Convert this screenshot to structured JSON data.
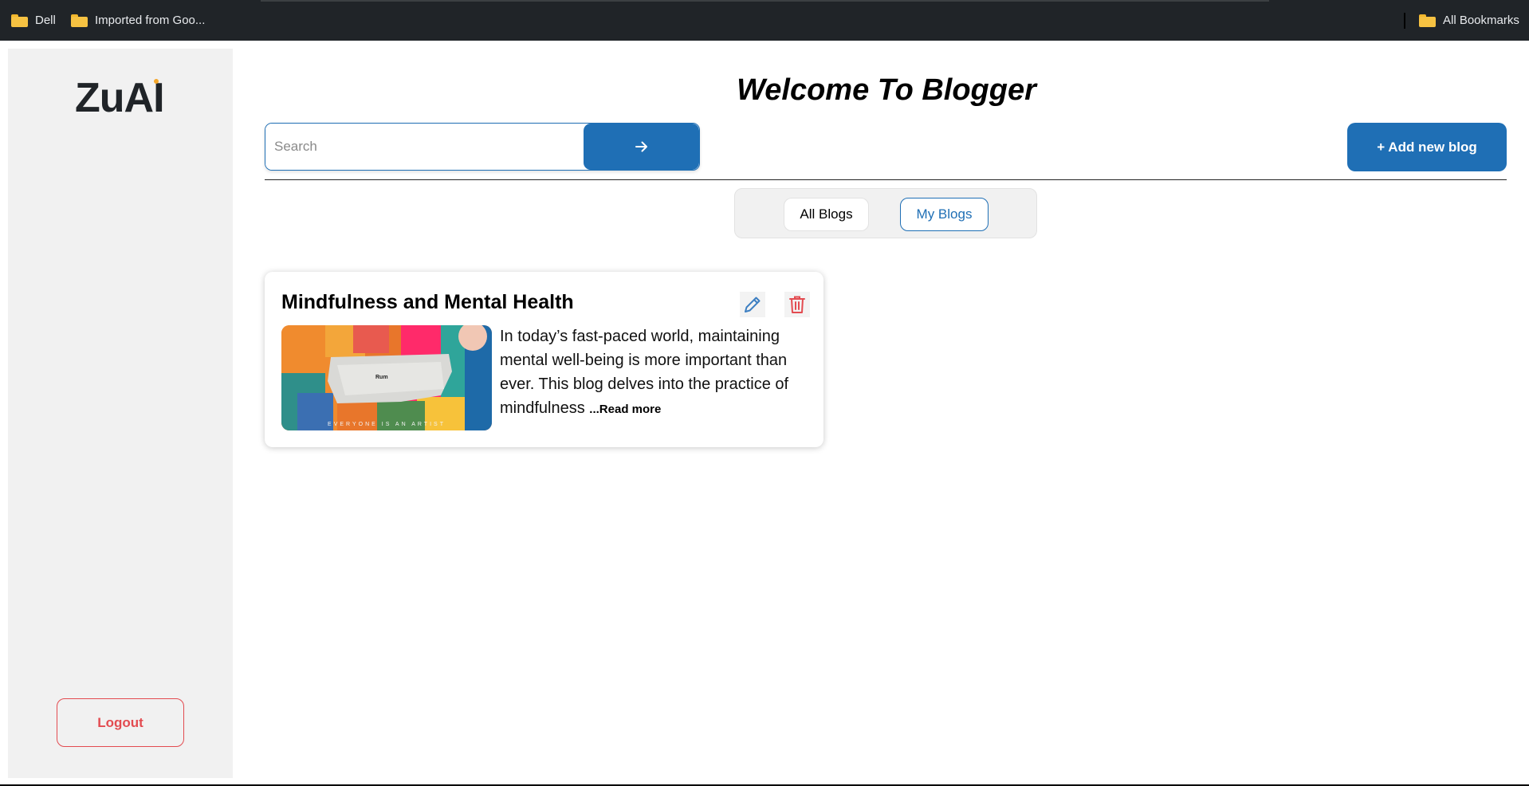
{
  "bookmarks": {
    "items": [
      {
        "label": "Dell",
        "icon": "folder-icon"
      },
      {
        "label": "Imported from Goo...",
        "icon": "folder-icon"
      }
    ],
    "all_bookmarks": {
      "label": "All Bookmarks",
      "icon": "folder-icon"
    }
  },
  "sidebar": {
    "logo": "ZuAI",
    "logout_label": "Logout"
  },
  "header": {
    "title": "Welcome To Blogger"
  },
  "search": {
    "placeholder": "Search",
    "value": "",
    "button_icon": "arrow-right-icon"
  },
  "toolbar": {
    "add_label": "+ Add new blog"
  },
  "tabs": {
    "items": [
      {
        "label": "All Blogs",
        "selected": false
      },
      {
        "label": "My Blogs",
        "selected": true
      }
    ]
  },
  "blogs": [
    {
      "title": "Mindfulness and Mental Health",
      "excerpt": "In today’s fast-paced world, maintaining mental well-being is more important than ever. This blog delves into the practice of mindfulness ",
      "ellipsis": "...",
      "read_more": "Read more",
      "image_caption": "EVERYONE IS AN ARTIST",
      "image_label": "Rum",
      "actions": [
        "pencil-icon",
        "trash-icon"
      ]
    }
  ],
  "colors": {
    "accent": "#1f6fb5",
    "danger": "#e34b50",
    "sidebar_bg": "#f1f1f1",
    "bookmarks_bg": "#202428"
  }
}
